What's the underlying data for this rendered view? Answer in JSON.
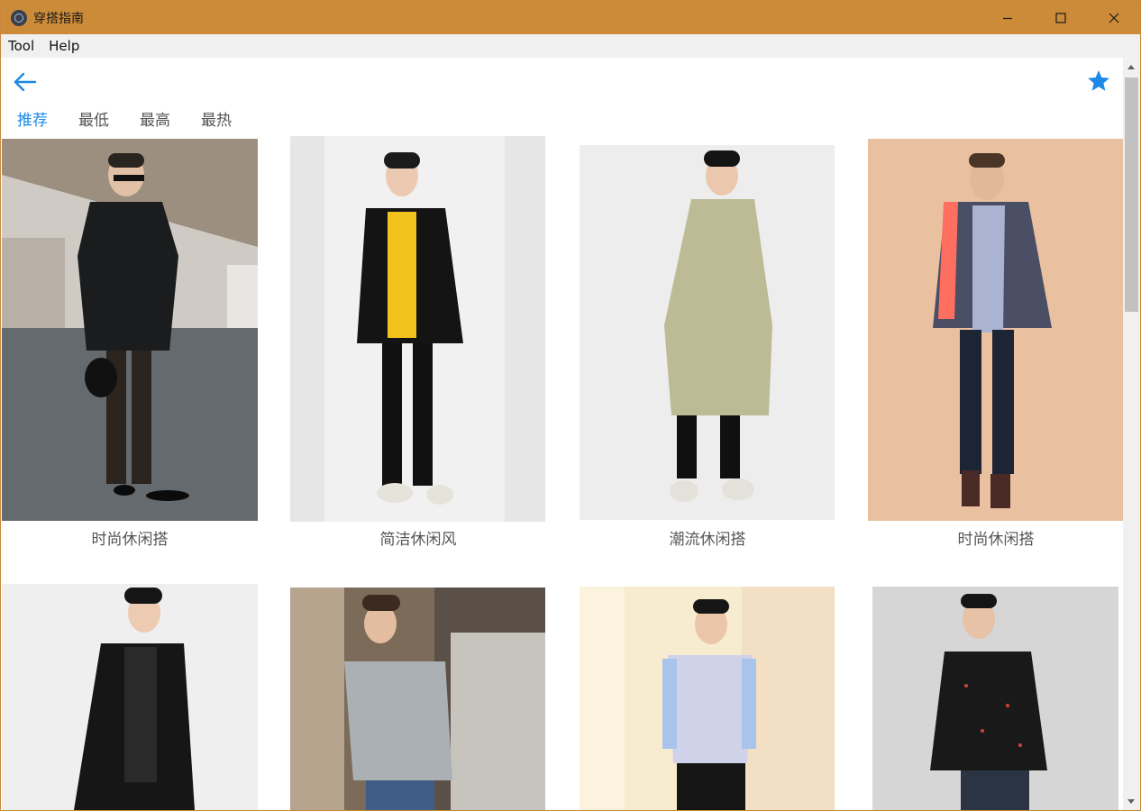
{
  "window": {
    "title": "穿搭指南",
    "accent_color": "#cc8b38"
  },
  "menu": {
    "items": [
      "Tool",
      "Help"
    ]
  },
  "toolbar": {
    "back_icon": "arrow-left-icon",
    "favorite_icon": "star-icon",
    "accent_color": "#1e88e5"
  },
  "tabs": [
    {
      "label": "推荐",
      "active": true
    },
    {
      "label": "最低",
      "active": false
    },
    {
      "label": "最高",
      "active": false
    },
    {
      "label": "最热",
      "active": false
    }
  ],
  "outfits": [
    {
      "caption": "时尚休闲搭"
    },
    {
      "caption": "简洁休闲风"
    },
    {
      "caption": "潮流休闲搭"
    },
    {
      "caption": "时尚休闲搭"
    },
    {
      "caption": ""
    },
    {
      "caption": ""
    },
    {
      "caption": ""
    },
    {
      "caption": ""
    }
  ]
}
